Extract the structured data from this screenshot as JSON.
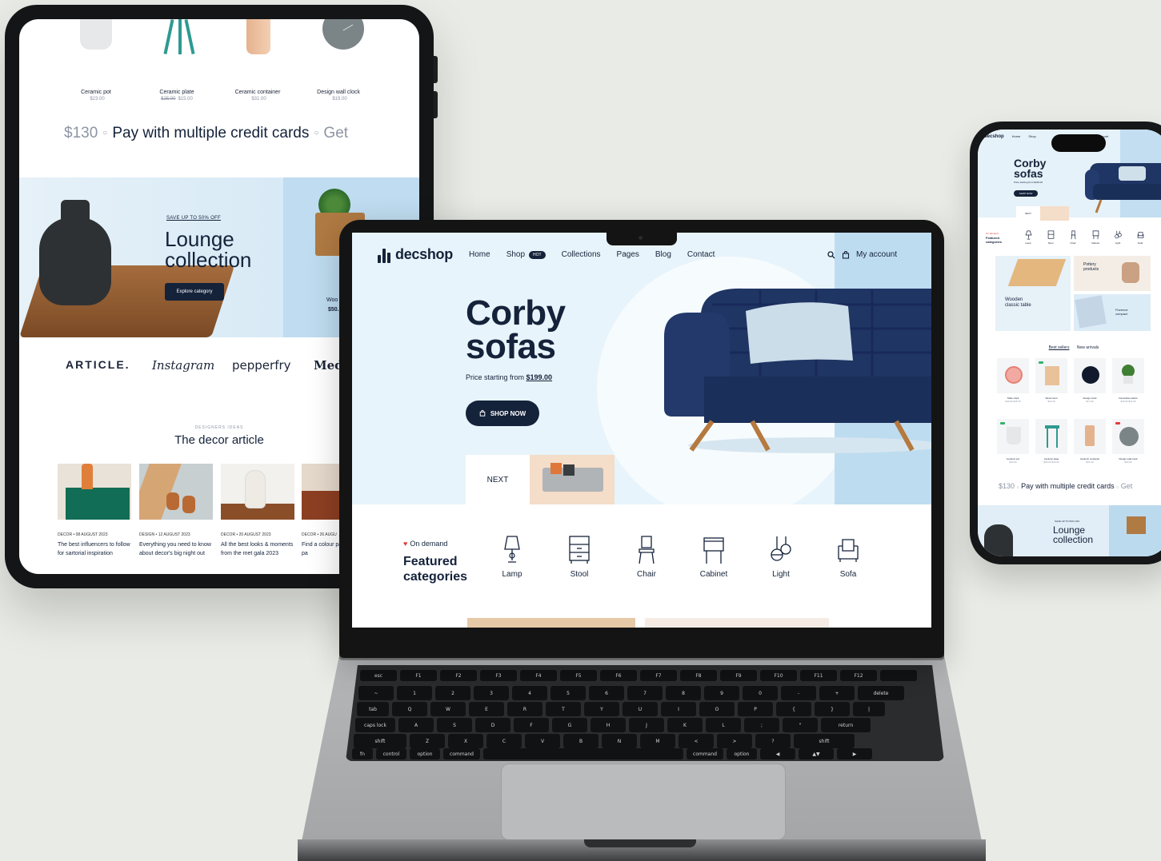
{
  "tablet": {
    "products": [
      {
        "name": "Ceramic pot",
        "price": "$23.00",
        "old_price": ""
      },
      {
        "name": "Ceramic plate",
        "price": "$15.00",
        "old_price": "$25.00"
      },
      {
        "name": "Ceramic container",
        "price": "$31.00",
        "old_price": ""
      },
      {
        "name": "Design wall clock",
        "price": "$19.00",
        "old_price": ""
      }
    ],
    "ticker": {
      "price": "$130",
      "text": "Pay with multiple credit cards",
      "next": "Get"
    },
    "lounge": {
      "sub": "SAVE UP TO 50% OFF",
      "title_line1": "Lounge",
      "title_line2": "collection",
      "button": "Explore category",
      "side_label": "Woo",
      "side_price": "$50."
    },
    "brands": [
      "ARTICLE.",
      "Instagram",
      "pepperfry",
      "Medi"
    ],
    "articles_head": {
      "small": "DESIGNERS IDEAS",
      "title": "The decor article"
    },
    "articles": [
      {
        "meta": "DECOR  •  08 AUGUST 2023",
        "title": "The best influencers to follow for sartorial inspiration"
      },
      {
        "meta": "DESIGN  •  12 AUGUST 2023",
        "title": "Everything you need to know about decor's big night out"
      },
      {
        "meta": "DECOR  •  20 AUGUST 2023",
        "title": "All the best looks & moments from the met gala 2023"
      },
      {
        "meta": "DECOR  •  26 AUGU",
        "title": "Find a colour pal reflects your pa"
      }
    ]
  },
  "laptop": {
    "logo": "decshop",
    "nav": [
      {
        "label": "Home"
      },
      {
        "label": "Shop",
        "badge": "HOT"
      },
      {
        "label": "Collections"
      },
      {
        "label": "Pages"
      },
      {
        "label": "Blog"
      },
      {
        "label": "Contact"
      }
    ],
    "account": "My account",
    "hero": {
      "title_line1": "Corby",
      "title_line2": "sofas",
      "price_prefix": "Price starting from ",
      "price": "$199.00",
      "button": "SHOP NOW",
      "next": "NEXT"
    },
    "featured": {
      "tag": "On demand",
      "title_line1": "Featured",
      "title_line2": "categories",
      "categories": [
        {
          "label": "Lamp",
          "icon": "lamp-icon"
        },
        {
          "label": "Stool",
          "icon": "stool-icon"
        },
        {
          "label": "Chair",
          "icon": "chair-icon"
        },
        {
          "label": "Cabinet",
          "icon": "cabinet-icon"
        },
        {
          "label": "Light",
          "icon": "light-icon"
        },
        {
          "label": "Sofa",
          "icon": "sofa-icon"
        }
      ]
    },
    "keyboard": {
      "fn_row": [
        "esc",
        "F1",
        "F2",
        "F3",
        "F4",
        "F5",
        "F6",
        "F7",
        "F8",
        "F9",
        "F10",
        "F11",
        "F12",
        ""
      ],
      "num_row": [
        "~",
        "1",
        "2",
        "3",
        "4",
        "5",
        "6",
        "7",
        "8",
        "9",
        "0",
        "-",
        "+",
        "delete"
      ],
      "q_row": [
        "tab",
        "Q",
        "W",
        "E",
        "R",
        "T",
        "Y",
        "U",
        "I",
        "O",
        "P",
        "{",
        "}",
        "|"
      ],
      "a_row": [
        "caps lock",
        "A",
        "S",
        "D",
        "F",
        "G",
        "H",
        "J",
        "K",
        "L",
        ";",
        "\"",
        "return"
      ],
      "z_row": [
        "shift",
        "Z",
        "X",
        "C",
        "V",
        "B",
        "N",
        "M",
        "<",
        ">",
        "?",
        "shift"
      ],
      "mod_row": [
        "fn",
        "control",
        "option",
        "command",
        "",
        "command",
        "option",
        "◀",
        "▲▼",
        "▶"
      ]
    }
  },
  "phone": {
    "logo": "decshop",
    "nav": [
      "Home",
      "Shop",
      "My account"
    ],
    "hero": {
      "title_line1": "Corby",
      "title_line2": "sofas",
      "price": "Price starting from $199.00",
      "button": "SHOP NOW",
      "next": "NEXT"
    },
    "featured": {
      "tag": "On demand",
      "title_line1": "Featured",
      "title_line2": "categories",
      "cats": [
        "Lamp",
        "Stool",
        "Chair",
        "Cabinet",
        "Light",
        "Sofa"
      ]
    },
    "tiles": {
      "pottery_1": "Pottery",
      "pottery_2": "products",
      "wooden_1": "Wooden",
      "wooden_2": "classic table",
      "florence_1": "Florence",
      "florence_2": "compact"
    },
    "tabs": [
      "Best sellers",
      "New arrivals"
    ],
    "grid": [
      {
        "name": "Table clock",
        "price": "$40.00 $25.00"
      },
      {
        "name": "Wood stool",
        "price": "$21.00"
      },
      {
        "name": "Design clock",
        "price": "$17.00"
      },
      {
        "name": "Decorative plants",
        "price": "$49.00 $31.00"
      },
      {
        "name": "Ceramic pot",
        "price": "$23.00"
      },
      {
        "name": "Ceramic plate",
        "price": "$25.00 $15.00"
      },
      {
        "name": "Ceramic container",
        "price": "$31.00"
      },
      {
        "name": "Design wall clock",
        "price": "$19.00"
      }
    ],
    "ticker": {
      "price": "$130",
      "text": "Pay with multiple credit cards",
      "next": "Get"
    },
    "lounge": {
      "sub": "SAVE UP TO 50% OFF",
      "title_line1": "Lounge",
      "title_line2": "collection"
    }
  },
  "colors": {
    "navy": "#14223a",
    "hero_bg": "#e8f4fb",
    "accent_blue": "#bedcf0",
    "heart": "#e23b3b",
    "sofa": "#1f3563"
  }
}
